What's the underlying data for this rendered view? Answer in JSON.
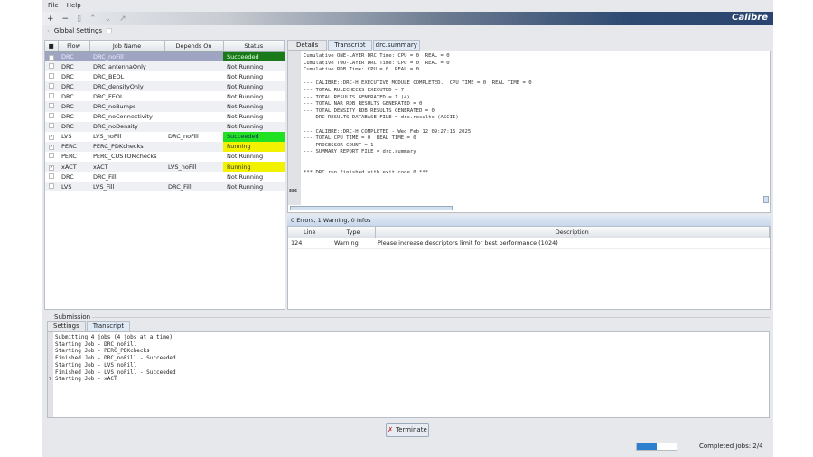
{
  "menu": [
    "File",
    "Help"
  ],
  "logo": "Calibre",
  "global_settings": "Global Settings",
  "jobs": {
    "columns": [
      "■",
      "Flow",
      "Job Name",
      "Depends On",
      "Status"
    ],
    "rows": [
      {
        "checked": true,
        "flow": "DRC",
        "name": "DRC_noFill",
        "depends": "",
        "status": "Succeeded",
        "style": "succ-dark",
        "selected": true
      },
      {
        "checked": false,
        "flow": "DRC",
        "name": "DRC_antennaOnly",
        "depends": "",
        "status": "Not Running"
      },
      {
        "checked": false,
        "flow": "DRC",
        "name": "DRC_BEOL",
        "depends": "",
        "status": "Not Running"
      },
      {
        "checked": false,
        "flow": "DRC",
        "name": "DRC_densityOnly",
        "depends": "",
        "status": "Not Running"
      },
      {
        "checked": false,
        "flow": "DRC",
        "name": "DRC_FEOL",
        "depends": "",
        "status": "Not Running"
      },
      {
        "checked": false,
        "flow": "DRC",
        "name": "DRC_noBumps",
        "depends": "",
        "status": "Not Running"
      },
      {
        "checked": false,
        "flow": "DRC",
        "name": "DRC_noConnectivity",
        "depends": "",
        "status": "Not Running"
      },
      {
        "checked": false,
        "flow": "DRC",
        "name": "DRC_noDensity",
        "depends": "",
        "status": "Not Running"
      },
      {
        "checked": true,
        "flow": "LVS",
        "name": "LVS_noFill",
        "depends": "DRC_noFill",
        "status": "Succeeded",
        "style": "succ"
      },
      {
        "checked": true,
        "flow": "PERC",
        "name": "PERC_PDKchecks",
        "depends": "",
        "status": "Running",
        "style": "run"
      },
      {
        "checked": false,
        "flow": "PERC",
        "name": "PERC_CUSTOMchecks",
        "depends": "",
        "status": "Not Running"
      },
      {
        "checked": true,
        "flow": "xACT",
        "name": "xACT",
        "depends": "LVS_noFill",
        "status": "Running",
        "style": "run"
      },
      {
        "checked": false,
        "flow": "DRC",
        "name": "DRC_Fill",
        "depends": "",
        "status": "Not Running"
      },
      {
        "checked": false,
        "flow": "LVS",
        "name": "LVS_Fill",
        "depends": "DRC_Fill",
        "status": "Not Running"
      }
    ]
  },
  "detail_tabs": [
    "Details",
    "Transcript",
    "drc.summary"
  ],
  "transcript": {
    "lines": [
      "Cumulative ONE-LAYER DRC Time: CPU = 0  REAL = 0",
      "Cumulative TWO-LAYER DRC Time: CPU = 0  REAL = 0",
      "Cumulative RDB Time: CPU = 0  REAL = 0",
      "",
      "--- CALIBRE::DRC-H EXECUTIVE MODULE COMPLETED.  CPU TIME = 0  REAL TIME = 0",
      "--- TOTAL RULECHECKS EXECUTED = 7",
      "--- TOTAL RESULTS GENERATED = 1 (4)",
      "--- TOTAL NAR RDB RESULTS GENERATED = 0",
      "--- TOTAL DENSITY RDB RESULTS GENERATED = 0",
      "--- DRC RESULTS DATABASE FILE = drc.results (ASCII)",
      "",
      "--- CALIBRE::DRC-H COMPLETED - Wed Feb 12 09:27:16 2025",
      "--- TOTAL CPU TIME = 0  REAL TIME = 0",
      "--- PROCESSOR COUNT = 1",
      "--- SUMMARY REPORT FILE = drc.summary",
      "",
      "",
      "*** DRC run finished with exit code 0 ***"
    ],
    "current_line": "886"
  },
  "results": {
    "summary": "0 Errors, 1 Warning, 0 Infos",
    "columns": [
      "Line",
      "Type",
      "Description"
    ],
    "rows": [
      {
        "line": "124",
        "type": "Warning",
        "desc": "Please increase descriptors limit for best performance (1024)"
      }
    ]
  },
  "submission": {
    "label": "Submission",
    "tabs": [
      "Settings",
      "Transcript"
    ],
    "lines": [
      "Submitting 4 jobs (4 jobs at a time)",
      "Starting Job - DRC_noFill",
      "Starting Job - PERC_PDKchecks",
      "Finished Job - DRC_noFill - Succeeded",
      "Starting Job - LVS_noFill",
      "Finished Job - LVS_noFill - Succeeded",
      "Starting Job - xACT"
    ],
    "gutter_mark": "7"
  },
  "terminate_label": "Terminate",
  "progress": 0.5,
  "completed_text": "Completed jobs: 2/4"
}
